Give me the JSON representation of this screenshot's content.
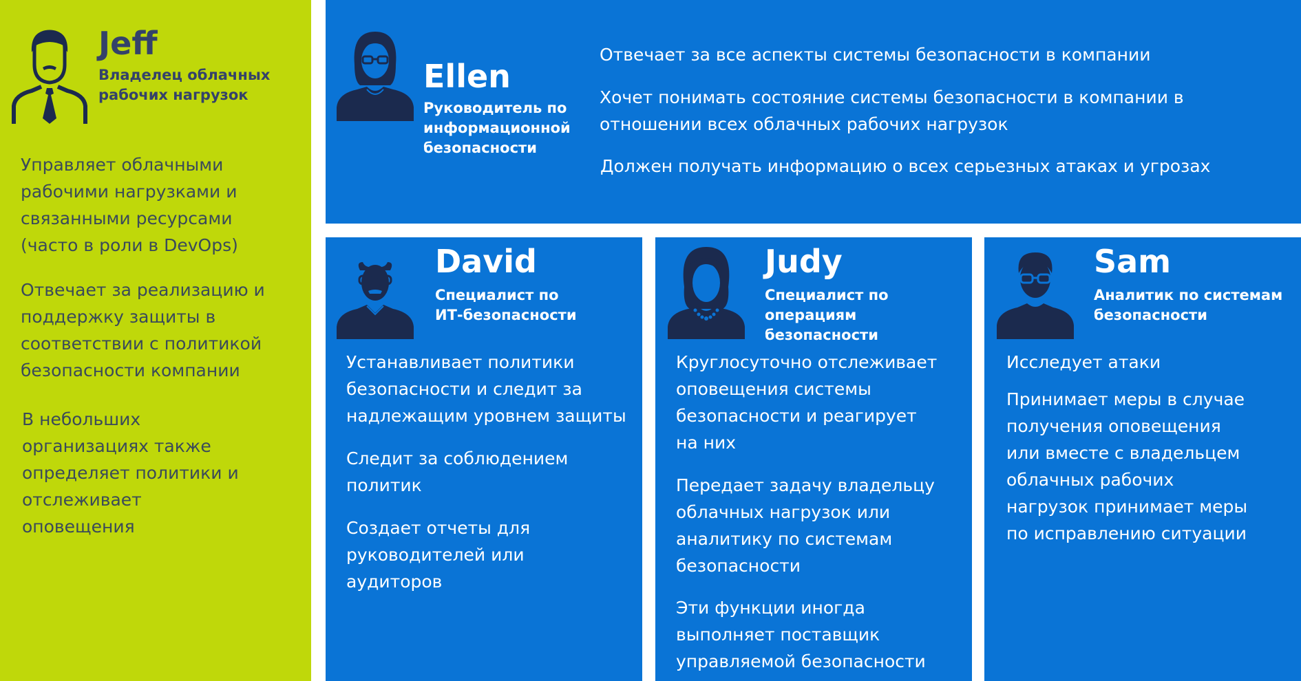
{
  "jeff": {
    "name": "Jeff",
    "role_line1": "Владелец облачных",
    "role_line2": "рабочих нагрузок",
    "paragraphs": [
      [
        "Управляет облачными",
        "рабочими нагрузками и",
        "связанными ресурсами",
        "(часто в роли в DevOps)"
      ],
      [
        "Отвечает за реализацию и",
        "поддержку защиты в",
        "соответствии с политикой",
        "безопасности компании"
      ],
      [
        "В небольших",
        "организациях также",
        "определяет политики и",
        "отслеживает",
        "оповещения"
      ]
    ]
  },
  "ellen": {
    "name": "Ellen",
    "role_lines": [
      "Руководитель по",
      "информационной",
      "безопасности"
    ],
    "paragraphs": [
      [
        "Отвечает за все аспекты системы безопасности в компании"
      ],
      [
        "Хочет понимать состояние системы безопасности в компании в",
        "отношении всех облачных рабочих нагрузок"
      ],
      [
        "Должен получать информацию о всех серьезных атаках и угрозах"
      ]
    ]
  },
  "david": {
    "name": "David",
    "role_lines": [
      "Специалист по",
      "ИТ-безопасности"
    ],
    "paragraphs": [
      [
        "Устанавливает политики",
        "безопасности и следит за",
        "надлежащим уровнем защиты"
      ],
      [
        "Следит за соблюдением",
        "политик"
      ],
      [
        "Создает отчеты для",
        "руководителей или",
        "аудиторов"
      ]
    ]
  },
  "judy": {
    "name": "Judy",
    "role_lines": [
      "Специалист по",
      "операциям безопасности"
    ],
    "paragraphs": [
      [
        "Круглосуточно отслеживает",
        "оповещения системы",
        "безопасности и реагирует",
        "на них"
      ],
      [
        "Передает задачу владельцу",
        "облачных нагрузок или",
        "аналитику по системам",
        "безопасности"
      ],
      [
        "Эти функции иногда",
        "выполняет поставщик",
        "управляемой безопасности"
      ]
    ]
  },
  "sam": {
    "name": "Sam",
    "role_lines": [
      "Аналитик по системам",
      "безопасности"
    ],
    "paragraphs": [
      [
        "Исследует атаки"
      ],
      [
        "Принимает меры в случае",
        "получения оповещения",
        "или вместе с владельцем",
        "облачных рабочих",
        "нагрузок принимает меры",
        "по исправлению ситуации"
      ]
    ]
  },
  "colors": {
    "green": "#bfd80a",
    "blue": "#0a74d6",
    "navy": "#1b2a4e"
  },
  "icons": [
    "person-tie-icon",
    "person-woman-glasses-icon",
    "person-man-glasses-icon",
    "person-woman-necklace-icon",
    "person-man-glasses-icon"
  ]
}
